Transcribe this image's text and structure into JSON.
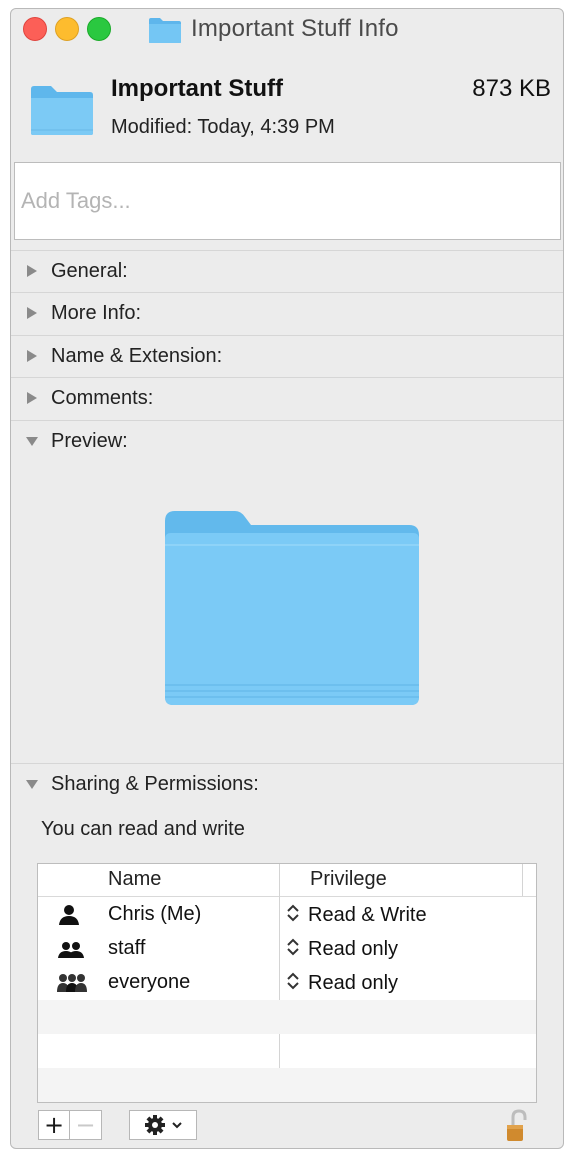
{
  "window": {
    "title": "Important Stuff Info"
  },
  "header": {
    "name": "Important Stuff",
    "size": "873 KB",
    "modified": "Modified: Today, 4:39 PM"
  },
  "tags": {
    "placeholder": "Add Tags..."
  },
  "sections": [
    {
      "label": "General:",
      "expanded": false
    },
    {
      "label": "More Info:",
      "expanded": false
    },
    {
      "label": "Name & Extension:",
      "expanded": false
    },
    {
      "label": "Comments:",
      "expanded": false
    },
    {
      "label": "Preview:",
      "expanded": true
    },
    {
      "label": "Sharing & Permissions:",
      "expanded": true
    }
  ],
  "sharing": {
    "summary": "You can read and write",
    "columns": {
      "name": "Name",
      "privilege": "Privilege"
    },
    "rows": [
      {
        "name": "Chris (Me)",
        "privilege": "Read & Write",
        "icon": "single-user-icon"
      },
      {
        "name": "staff",
        "privilege": "Read only",
        "icon": "group-icon"
      },
      {
        "name": "everyone",
        "privilege": "Read only",
        "icon": "everyone-icon"
      }
    ]
  },
  "toolbar": {
    "add_label": "+",
    "remove_label": "−"
  },
  "colors": {
    "folder_blue": "#6fc3f3",
    "close": "#fc5f57",
    "minimize": "#fdbc2e",
    "maximize": "#2ac840"
  }
}
